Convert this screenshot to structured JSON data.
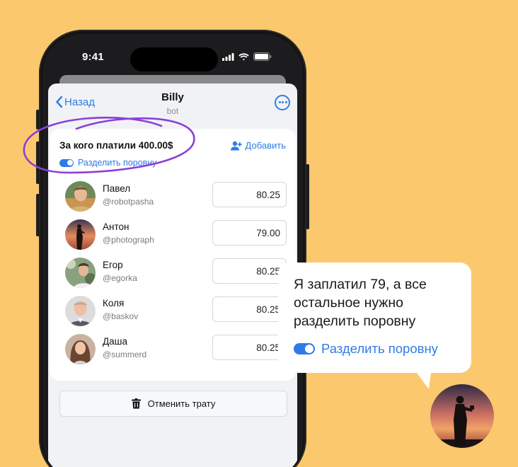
{
  "status": {
    "time": "9:41"
  },
  "nav": {
    "back_label": "Назад",
    "title": "Billy",
    "subtitle": "bot"
  },
  "card": {
    "title": "За кого платили 400.00$",
    "add_label": "Добавить",
    "split_label": "Разделить поровну"
  },
  "people": [
    {
      "name": "Павел",
      "username": "@robotpasha",
      "amount": "80.25"
    },
    {
      "name": "Антон",
      "username": "@photograph",
      "amount": "79.00"
    },
    {
      "name": "Егор",
      "username": "@egorka",
      "amount": "80.25"
    },
    {
      "name": "Коля",
      "username": "@baskov",
      "amount": "80.25"
    },
    {
      "name": "Даша",
      "username": "@summerd",
      "amount": "80.25"
    }
  ],
  "cancel_label": "Отменить трату",
  "bubble": {
    "text": "Я заплатил 79, а все остальное нужно разделить поровну",
    "toggle_label": "Разделить поровну"
  },
  "colors": {
    "background": "#fcc86e",
    "accent": "#2f7be6",
    "annotation": "#8a3fd6"
  }
}
